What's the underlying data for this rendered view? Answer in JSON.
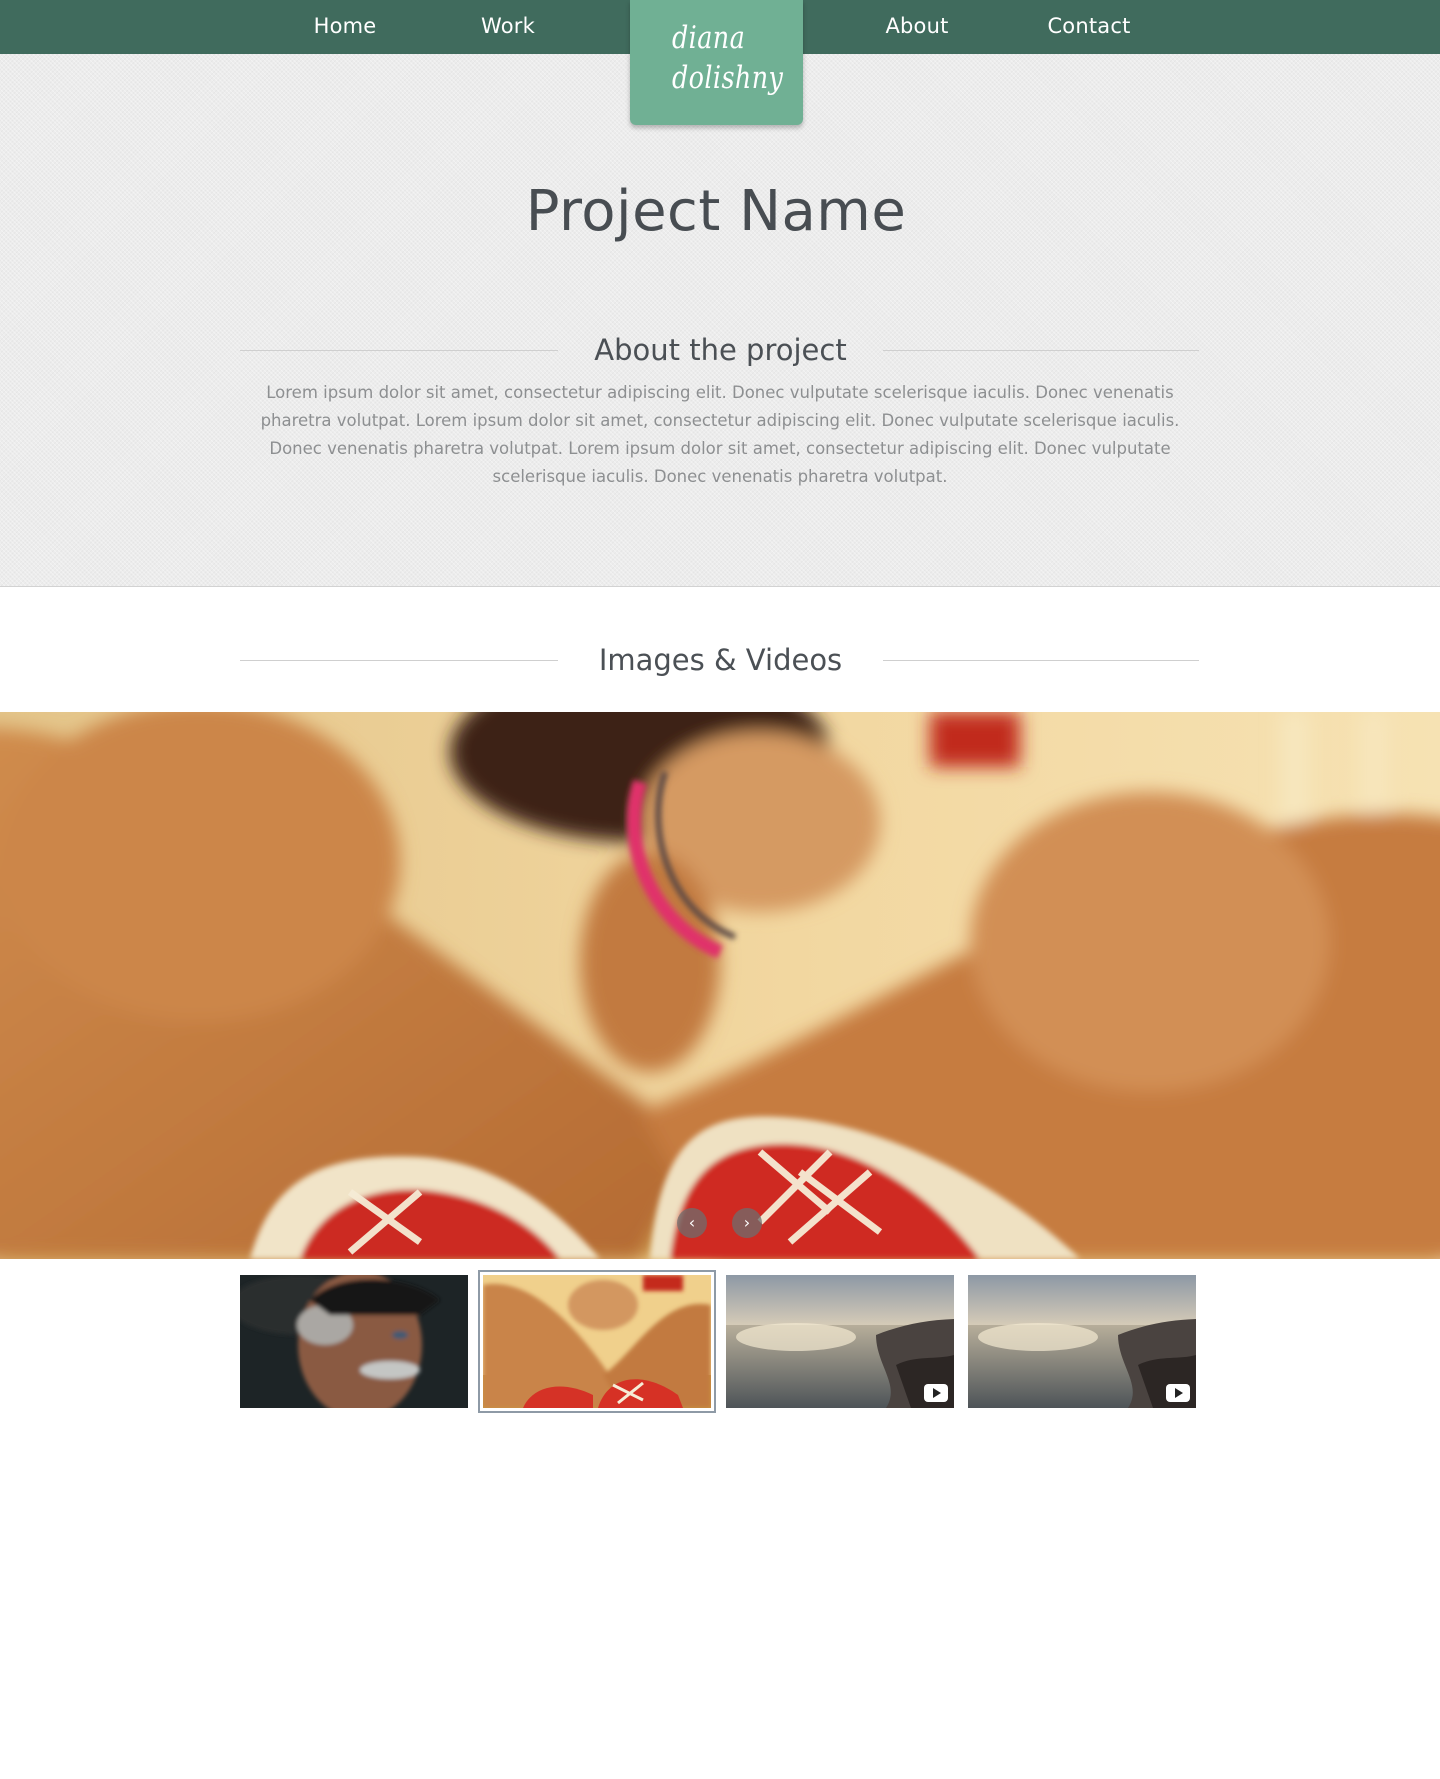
{
  "nav": {
    "items": [
      {
        "label": "Home"
      },
      {
        "label": "Work"
      },
      {
        "label": "About"
      },
      {
        "label": "Contact"
      }
    ],
    "logo": {
      "line1": "diana",
      "line2": "dolishny"
    }
  },
  "hero": {
    "title": "Project Name",
    "about_heading": "About the project",
    "about_text": "Lorem ipsum dolor sit amet, consectetur adipiscing elit. Donec vulputate scelerisque iaculis. Donec venenatis pharetra volutpat. Lorem ipsum dolor sit amet, consectetur adipiscing elit. Donec vulputate scelerisque iaculis. Donec venenatis pharetra volutpat. Lorem ipsum dolor sit amet, consectetur adipiscing elit. Donec vulputate scelerisque iaculis. Donec venenatis pharetra volutpat."
  },
  "media": {
    "heading": "Images & Videos",
    "slider": {
      "prev_icon": "chevron-left-icon",
      "next_icon": "chevron-right-icon",
      "prev_glyph": "‹",
      "next_glyph": "›"
    },
    "thumbnails": [
      {
        "kind": "image",
        "subject": "old-man-portrait",
        "active": false
      },
      {
        "kind": "image",
        "subject": "sneakers-girl",
        "active": true
      },
      {
        "kind": "video",
        "subject": "coastline",
        "active": false
      },
      {
        "kind": "video",
        "subject": "coastline",
        "active": false
      }
    ]
  },
  "colors": {
    "nav_bg": "#406b5d",
    "logo_bg": "#70b094",
    "hero_bg": "#ececec",
    "title_text": "#484d52",
    "body_text": "#8d8f91"
  }
}
